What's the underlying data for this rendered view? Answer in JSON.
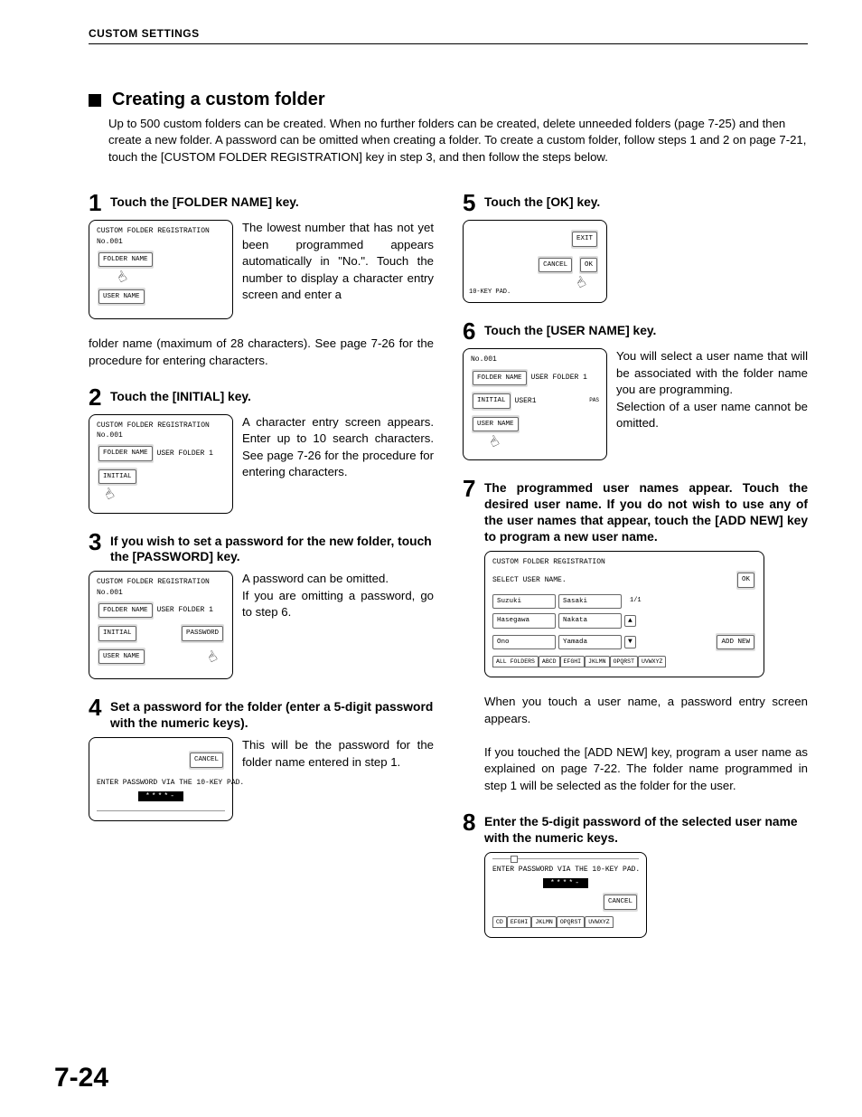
{
  "header": "CUSTOM SETTINGS",
  "page_number": "7-24",
  "section": {
    "title": "Creating a custom folder",
    "intro": "Up to 500 custom folders can be created. When no further folders can be created, delete unneeded folders (page 7-25) and then create a new folder. A password can be omitted when creating a folder. To create a custom folder, follow steps 1 and 2 on page 7-21, touch the [CUSTOM FOLDER REGISTRATION] key in step 3, and then follow the steps below."
  },
  "steps": {
    "s1": {
      "n": "1",
      "head": "Touch the [FOLDER NAME] key.",
      "text": "The lowest number that has not yet been programmed appears automatically in \"No.\". Touch the number to display a character entry screen and enter a",
      "cont": "folder name (maximum of 28 characters). See page 7-26 for the procedure for entering characters.",
      "fig": {
        "title": "CUSTOM FOLDER REGISTRATION",
        "no": "No.001",
        "b1": "FOLDER NAME",
        "b2": "USER NAME"
      }
    },
    "s2": {
      "n": "2",
      "head": "Touch the [INITIAL] key.",
      "text": "A character entry screen appears. Enter up to 10 search characters. See page 7-26 for the procedure for entering characters.",
      "fig": {
        "title": "CUSTOM FOLDER REGISTRATION",
        "no": "No.001",
        "b1": "FOLDER NAME",
        "val1": "USER FOLDER 1",
        "b2": "INITIAL"
      }
    },
    "s3": {
      "n": "3",
      "head": "If you wish to set a password for the new folder, touch the [PASSWORD] key.",
      "text1": "A password can be omitted.",
      "text2": "If you are omitting a password, go to step 6.",
      "fig": {
        "title": "CUSTOM FOLDER REGISTRATION",
        "no": "No.001",
        "b1": "FOLDER NAME",
        "val1": "USER FOLDER 1",
        "b2": "INITIAL",
        "b3": "PASSWORD",
        "b4": "USER NAME"
      }
    },
    "s4": {
      "n": "4",
      "head": "Set a password for the folder (enter a 5-digit password with the numeric keys).",
      "text": "This will be the password for the folder name entered in step 1.",
      "fig": {
        "cancel": "CANCEL",
        "hint": "ENTER PASSWORD VIA THE 10-KEY PAD.",
        "mask": "****-"
      }
    },
    "s5": {
      "n": "5",
      "head": "Touch the [OK] key.",
      "fig": {
        "exit": "EXIT",
        "cancel": "CANCEL",
        "ok": "OK",
        "pad": "10-KEY PAD."
      }
    },
    "s6": {
      "n": "6",
      "head": "Touch the [USER NAME] key.",
      "text1": "You will select a user name that will be associated with the folder name you are programming.",
      "text2": "Selection of a user name cannot be omitted.",
      "fig": {
        "no": "No.001",
        "b1": "FOLDER NAME",
        "val1": "USER FOLDER 1",
        "b2": "INITIAL",
        "val2": "USER1",
        "pas": "PAS",
        "b3": "USER NAME"
      }
    },
    "s7": {
      "n": "7",
      "head": "The programmed user names appear. Touch the desired user name. If you do not wish to use any of the user names that appear, touch the [ADD NEW] key to program a new user name.",
      "text1": "When you touch a user name, a password entry screen appears.",
      "text2": "If you touched the [ADD NEW] key, program a user name as explained on page 7-22. The folder name programmed in step 1 will be selected as the folder for the user.",
      "fig": {
        "title": "CUSTOM FOLDER REGISTRATION",
        "sub": "SELECT USER NAME.",
        "ok": "OK",
        "u": [
          "Suzuki",
          "Sasaki",
          "Hasegawa",
          "Nakata",
          "Ono",
          "Yamada"
        ],
        "page": "1/1",
        "addnew": "ADD NEW",
        "tabs": [
          "ALL FOLDERS",
          "ABCD",
          "EFGHI",
          "JKLMN",
          "OPQRST",
          "UVWXYZ"
        ]
      }
    },
    "s8": {
      "n": "8",
      "head": "Enter the 5-digit password of the selected user name with the numeric keys.",
      "fig": {
        "hint": "ENTER PASSWORD VIA THE 10-KEY PAD.",
        "mask": "****-",
        "cancel": "CANCEL",
        "tabs": [
          "CD",
          "EFGHI",
          "JKLMN",
          "OPQRST",
          "UVWXYZ"
        ]
      }
    }
  }
}
